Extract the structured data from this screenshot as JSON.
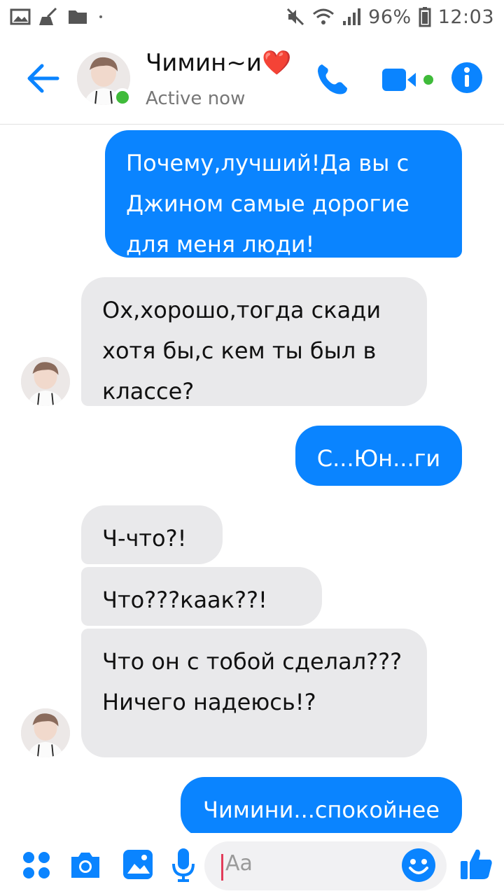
{
  "status_bar": {
    "battery": "96%",
    "time": "12:03",
    "icons": [
      "image-icon",
      "broom-icon",
      "folder-icon",
      "mute-icon",
      "wifi-icon",
      "signal-icon",
      "battery-icon"
    ]
  },
  "header": {
    "contact_name": "Чимин~и❤️",
    "status": "Active now",
    "icons": [
      "back-arrow-icon",
      "phone-icon",
      "video-camera-icon",
      "info-icon"
    ],
    "accent": "#0a84ff",
    "active_color": "#3fbb3a"
  },
  "messages": [
    {
      "direction": "out",
      "text": "Почему,лучший!Да вы с Джином самые дорогие для меня люди!"
    },
    {
      "direction": "in",
      "text": "Ох,хорошо,тогда скади хотя бы,с кем ты был в классе?"
    },
    {
      "direction": "out",
      "text": "С...Юн...ги"
    },
    {
      "direction": "in",
      "text": "Ч-что?!"
    },
    {
      "direction": "in",
      "text": "Что???каак??!"
    },
    {
      "direction": "in",
      "text": "Что он с тобой сделал???Ничего надеюсь!?"
    },
    {
      "direction": "out",
      "text": "Чимини...спокойнее"
    }
  ],
  "composer": {
    "placeholder": "Aa",
    "icons": [
      "apps-grid-icon",
      "camera-icon",
      "gallery-icon",
      "microphone-icon",
      "emoji-icon",
      "thumbs-up-icon"
    ]
  },
  "colors": {
    "outgoing_bubble": "#0a84ff",
    "incoming_bubble": "#e9e9eb"
  }
}
